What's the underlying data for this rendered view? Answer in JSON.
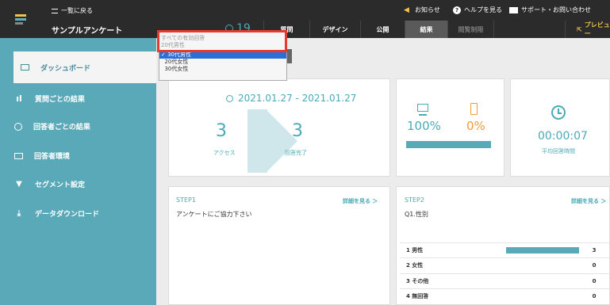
{
  "header": {
    "back_label": "一覧に戻る",
    "survey_title": "サンプルアンケート",
    "response_count": "19",
    "notice_label": "お知らせ",
    "help_label": "ヘルプを見る",
    "support_label": "サポート・お問い合わせ",
    "tabs": [
      {
        "label": "質問"
      },
      {
        "label": "デザイン"
      },
      {
        "label": "公開"
      },
      {
        "label": "結果"
      },
      {
        "label": "閲覧制限"
      }
    ],
    "preview_label": "プレビュー"
  },
  "sidebar": {
    "items": [
      {
        "label": "ダッシュボード"
      },
      {
        "label": "質問ごとの結果"
      },
      {
        "label": "回答者ごとの結果"
      },
      {
        "label": "回答者環境"
      },
      {
        "label": "セグメント設定"
      },
      {
        "label": "データダウンロード"
      }
    ]
  },
  "filter": {
    "options": [
      "すべての有効回答",
      "20代男性",
      "30代男性",
      "20代女性",
      "30代女性"
    ],
    "selected": "30代男性"
  },
  "summary": {
    "period": "2021.01.27 - 2021.01.27",
    "access_count": "3",
    "access_label": "アクセス",
    "complete_count": "3",
    "complete_label": "回答完了",
    "pc_pct": "100%",
    "mobile_pct": "0%",
    "pc_fraction": 1.0,
    "avg_time": "00:00:07",
    "avg_time_label": "平均回答時間"
  },
  "step1": {
    "title": "STEP1",
    "detail_link": "詳細を見る ＞",
    "question": "アンケートにご協力下さい"
  },
  "step2": {
    "title": "STEP2",
    "detail_link": "詳細を見る ＞",
    "question": "Q1.性別",
    "rows": [
      {
        "label": "1  男性",
        "value": "3",
        "fraction": 1.0
      },
      {
        "label": "2  女性",
        "value": "0",
        "fraction": 0
      },
      {
        "label": "3  その他",
        "value": "0",
        "fraction": 0
      },
      {
        "label": "4  無回答",
        "value": "0",
        "fraction": 0
      }
    ]
  },
  "colors": {
    "accent": "#5aa9b8",
    "mobile": "#f19b3c",
    "highlight": "#e8392f",
    "selection": "#2b6fd6"
  }
}
